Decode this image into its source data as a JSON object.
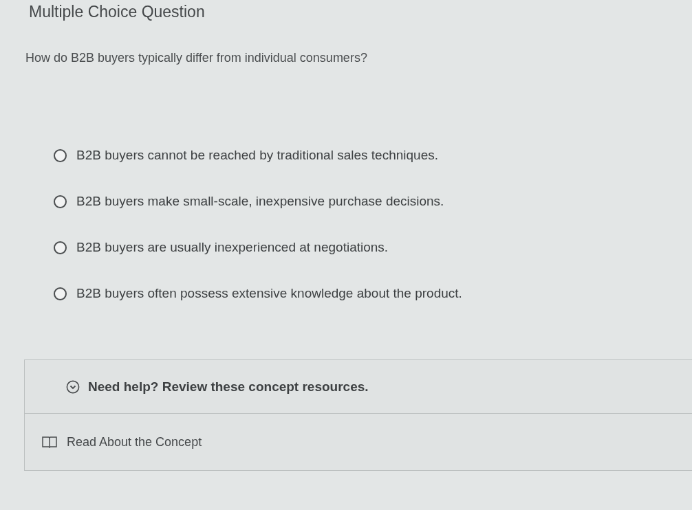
{
  "title": "Multiple Choice Question",
  "question": "How do B2B buyers typically differ from individual consumers?",
  "options": [
    {
      "label": "B2B buyers cannot be reached by traditional sales techniques.",
      "selected": false
    },
    {
      "label": "B2B buyers make small-scale, inexpensive purchase decisions.",
      "selected": false
    },
    {
      "label": "B2B buyers are usually inexperienced at negotiations.",
      "selected": false
    },
    {
      "label": "B2B buyers often possess extensive knowledge about the product.",
      "selected": false
    }
  ],
  "help": {
    "heading": "Need help? Review these concept resources.",
    "resources": [
      {
        "label": "Read About the Concept"
      }
    ]
  }
}
